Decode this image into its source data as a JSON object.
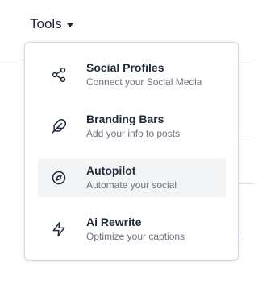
{
  "header": {
    "tools_label": "Tools"
  },
  "menu": {
    "items": [
      {
        "id": "social-profiles",
        "title": "Social Profiles",
        "subtitle": "Connect your Social Media",
        "icon": "share-icon",
        "active": false
      },
      {
        "id": "branding-bars",
        "title": "Branding Bars",
        "subtitle": "Add your info to posts",
        "icon": "feather-icon",
        "active": false
      },
      {
        "id": "autopilot",
        "title": "Autopilot",
        "subtitle": "Automate your social",
        "icon": "compass-icon",
        "active": true
      },
      {
        "id": "ai-rewrite",
        "title": "Ai Rewrite",
        "subtitle": "Optimize your captions",
        "icon": "bolt-icon",
        "active": false
      }
    ]
  },
  "colors": {
    "text_primary": "#1f2937",
    "text_secondary": "#6b7280",
    "hover_bg": "#f3f4f6",
    "border": "#d6d6d6"
  }
}
